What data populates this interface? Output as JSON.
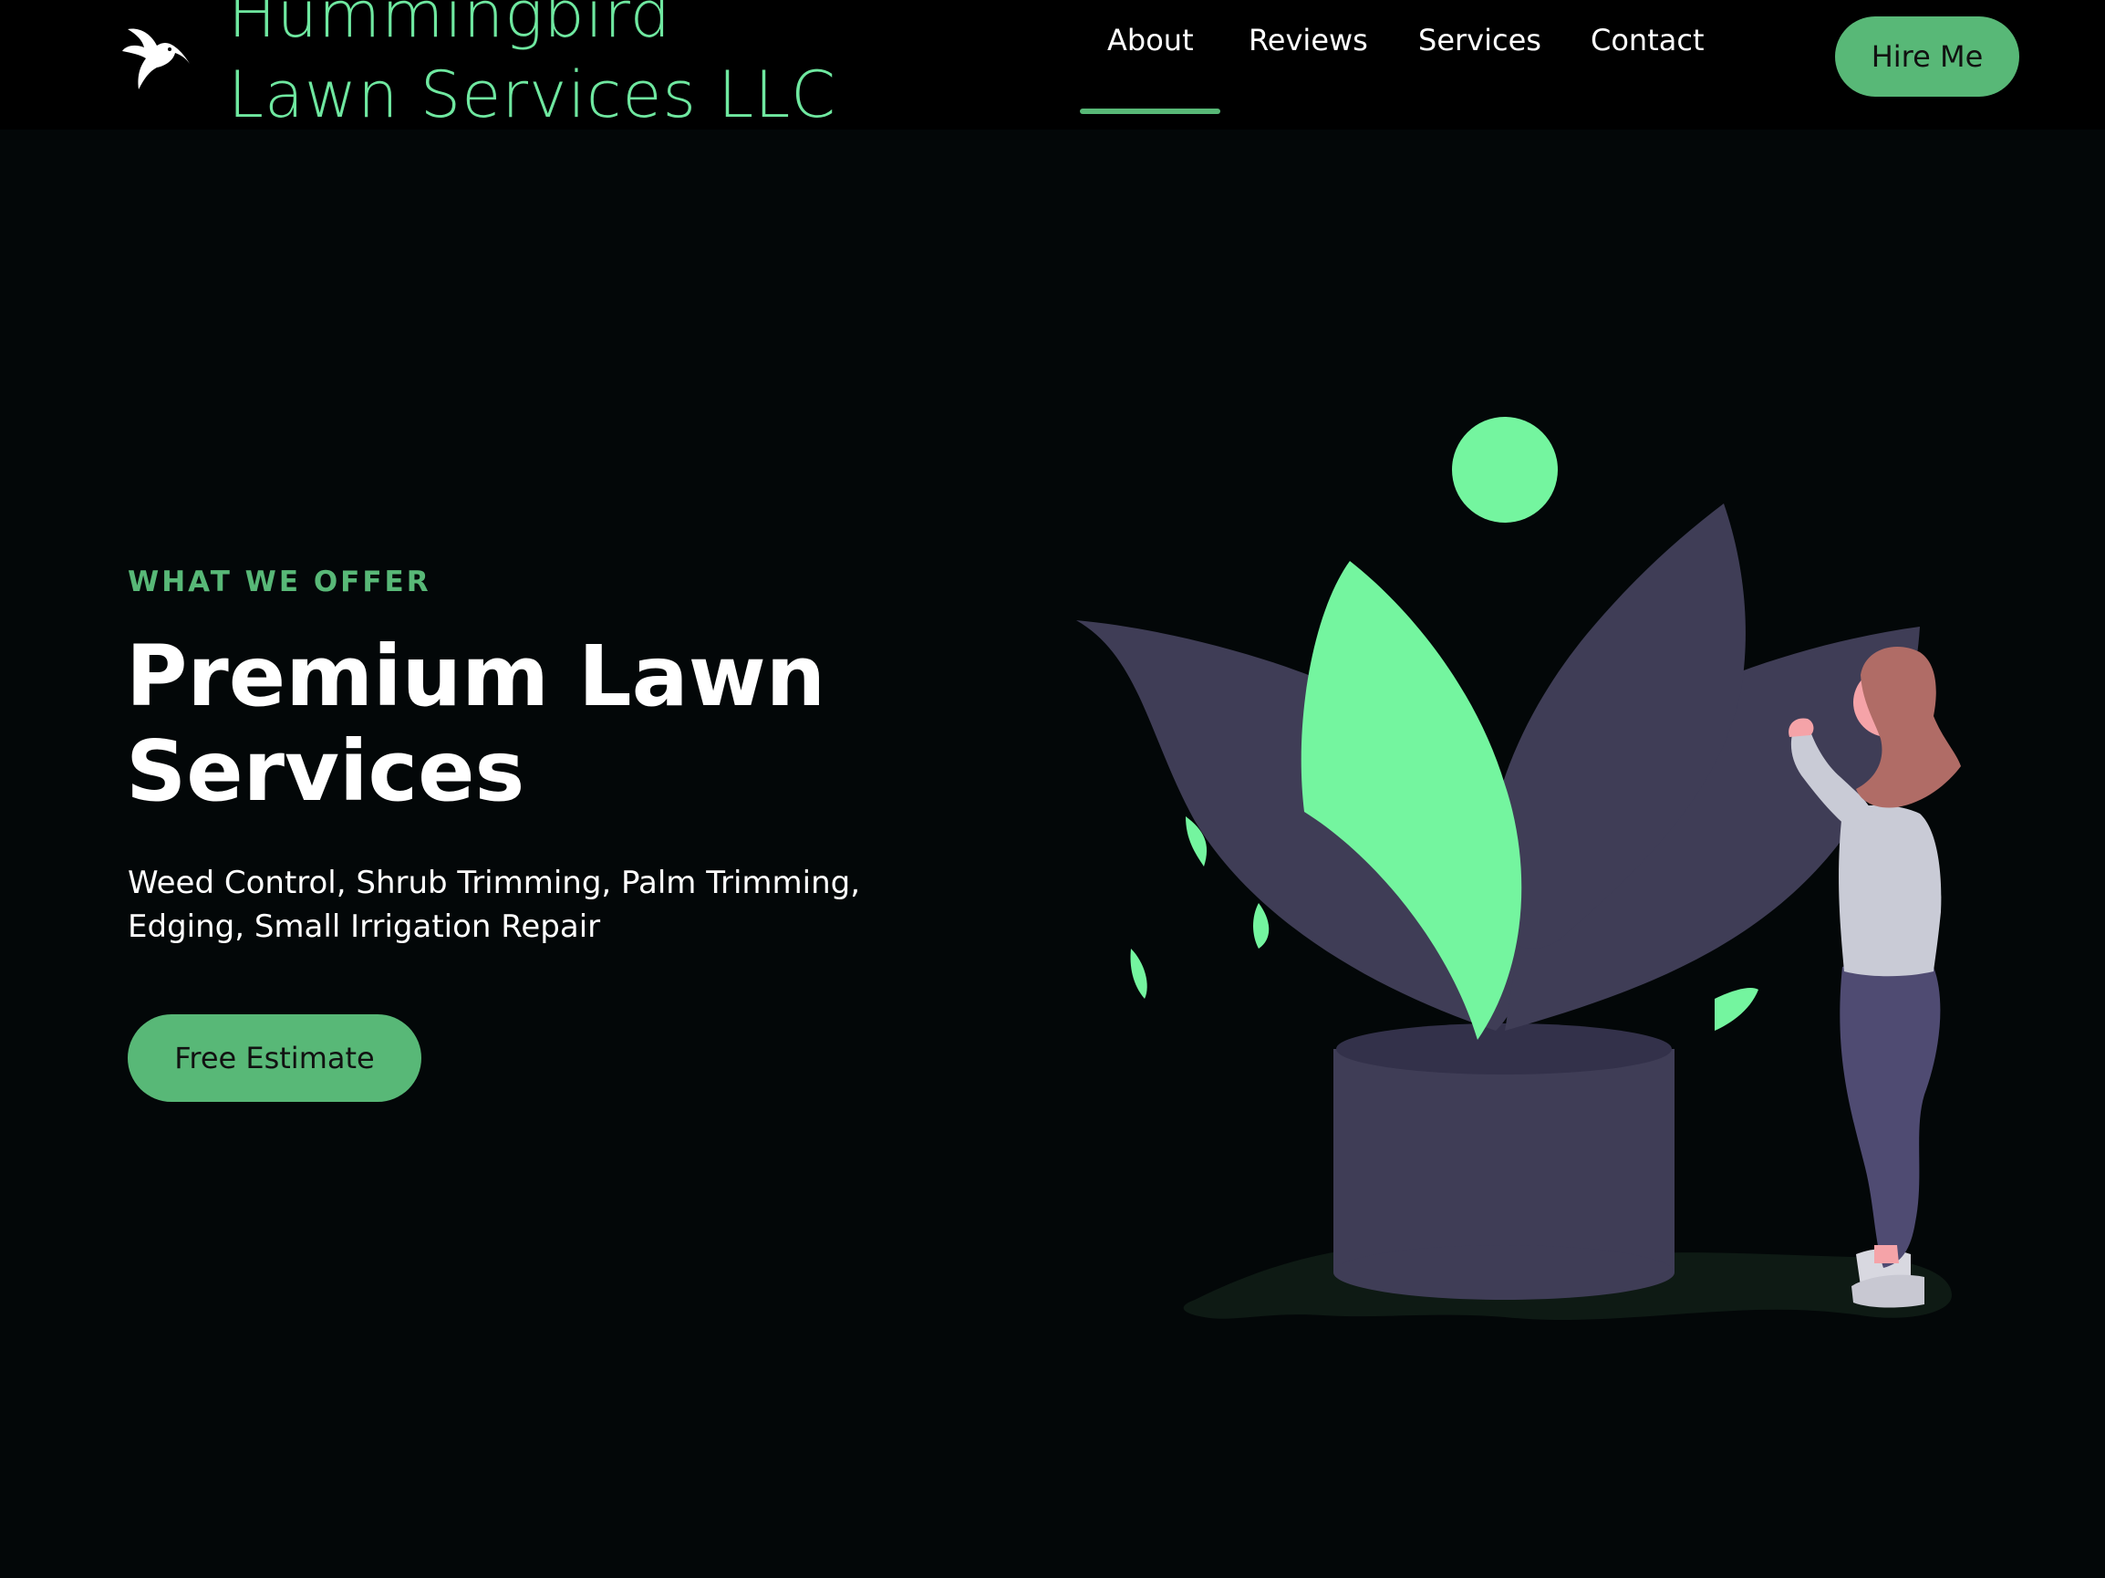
{
  "header": {
    "brand_line1": "Hummingbird",
    "brand_line2": "Lawn Services LLC",
    "logo_icon": "hummingbird-icon",
    "nav": [
      {
        "label": "About",
        "active": true
      },
      {
        "label": "Reviews",
        "active": false
      },
      {
        "label": "Services",
        "active": false
      },
      {
        "label": "Contact",
        "active": false
      }
    ],
    "cta_label": "Hire Me"
  },
  "hero": {
    "eyebrow": "WHAT WE OFFER",
    "title_line1": "Premium Lawn",
    "title_line2": "Services",
    "subtitle_line1": "Weed Control, Shrub Trimming, Palm Trimming,",
    "subtitle_line2": "Edging, Small Irrigation Repair",
    "cta_label": "Free Estimate",
    "illustration": "woman-with-giant-plant-illustration"
  },
  "colors": {
    "background": "#030708",
    "header_background": "#000000",
    "brand_green": "#6fe8a0",
    "accent_green": "#58b877",
    "leaf_green": "#74f59f",
    "petal_dark": "#3f3d56",
    "text_white": "#ffffff"
  }
}
